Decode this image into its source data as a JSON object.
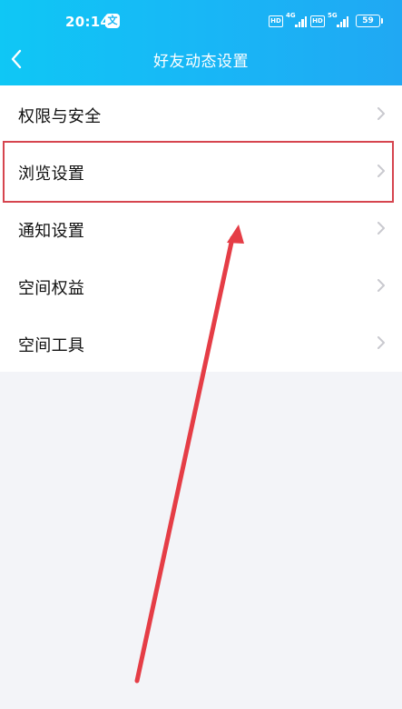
{
  "status_bar": {
    "time": "20:14",
    "notification_icon": "app-notification-icon",
    "hd_label": "HD",
    "network_1": "4G",
    "network_2": "5G",
    "battery": "59"
  },
  "header": {
    "title": "好友动态设置",
    "back_icon": "chevron-left-icon"
  },
  "menu": {
    "items": [
      {
        "label": "权限与安全"
      },
      {
        "label": "浏览设置"
      },
      {
        "label": "通知设置"
      },
      {
        "label": "空间权益"
      },
      {
        "label": "空间工具"
      }
    ],
    "chevron_icon": "chevron-right-icon"
  },
  "annotation": {
    "highlight_color": "#d6454f",
    "arrow_color": "#e53d46"
  }
}
